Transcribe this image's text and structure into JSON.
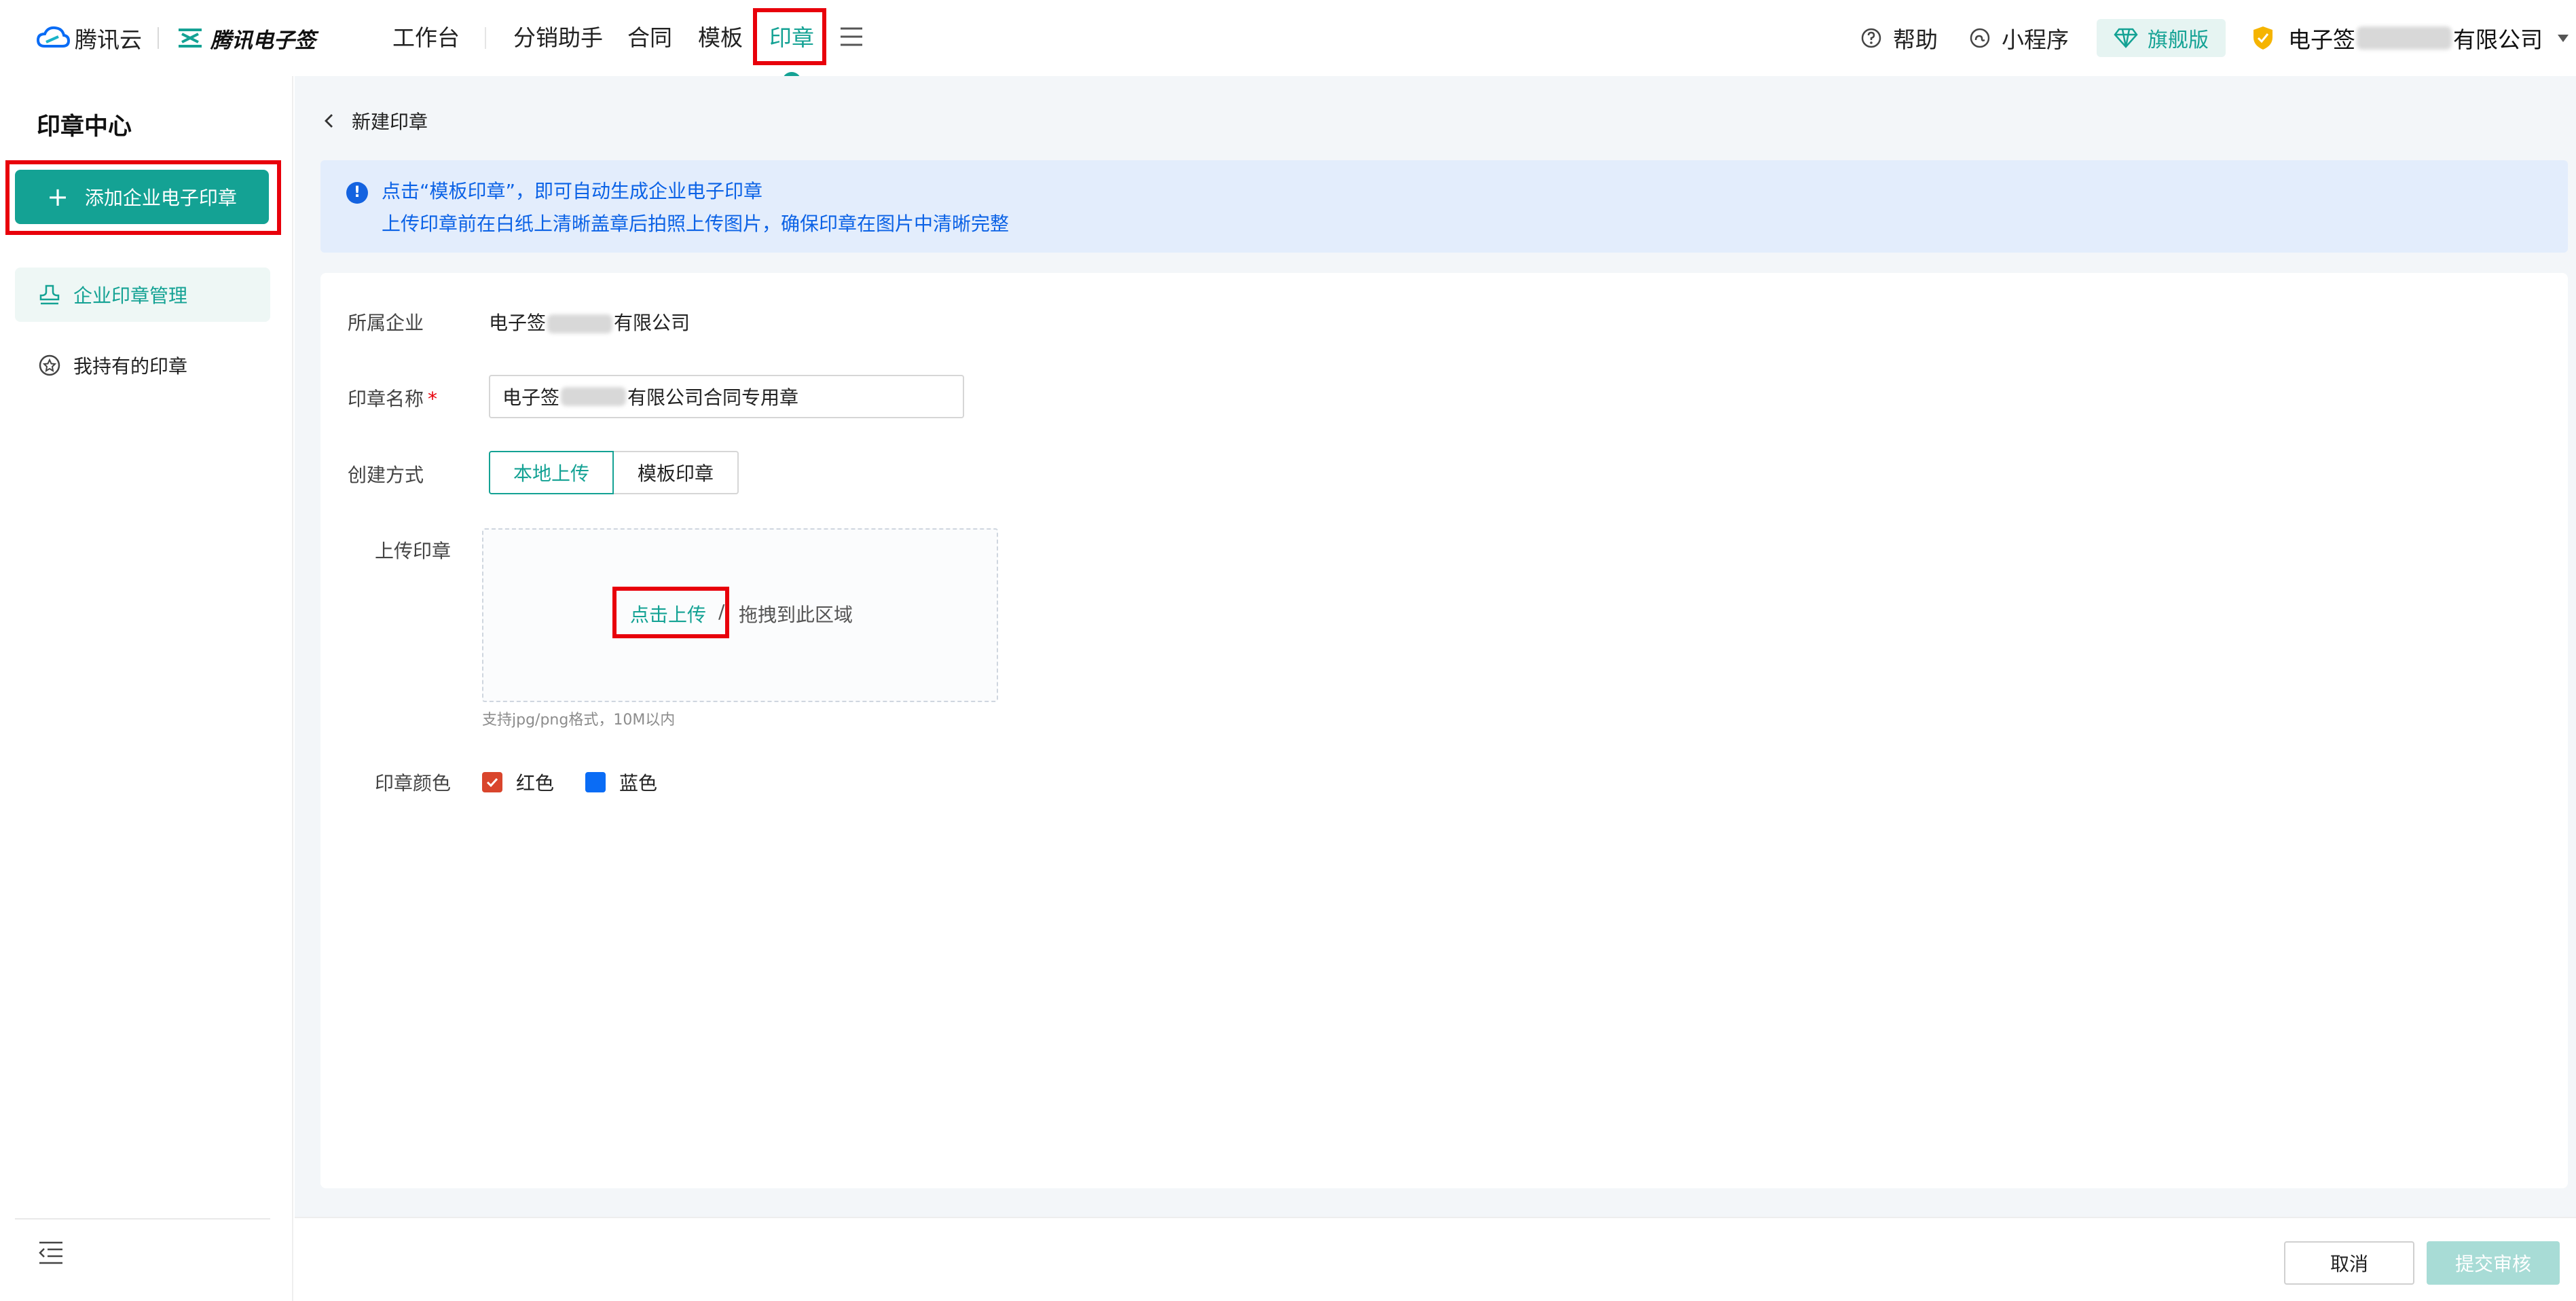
{
  "topbar": {
    "brand_tencent": "腾讯云",
    "brand_esign": "腾讯电子签",
    "nav": [
      {
        "label": "工作台"
      },
      {
        "label": "分销助手"
      },
      {
        "label": "合同"
      },
      {
        "label": "模板"
      },
      {
        "label": "印章",
        "active": true
      }
    ],
    "help_label": "帮助",
    "miniprogram_label": "小程序",
    "flagship_label": "旗舰版",
    "company_prefix": "电子签",
    "company_suffix": "有限公司"
  },
  "sidebar": {
    "title": "印章中心",
    "add_button": "添加企业电子印章",
    "items": [
      {
        "label": "企业印章管理",
        "active": true
      },
      {
        "label": "我持有的印章",
        "active": false
      }
    ]
  },
  "main": {
    "back_label": "新建印章",
    "notice_lines": [
      "点击“模板印章”，即可自动生成企业电子印章",
      "上传印章前在白纸上清晰盖章后拍照上传图片，确保印章在图片中清晰完整"
    ],
    "form": {
      "company_label": "所属企业",
      "company_prefix": "电子签",
      "company_suffix": "有限公司",
      "name_label": "印章名称",
      "name_required": "*",
      "name_prefix": "电子签",
      "name_suffix": "有限公司合同专用章",
      "method_label": "创建方式",
      "method_options": [
        "本地上传",
        "模板印章"
      ],
      "upload_label": "上传印章",
      "upload_link": "点击上传",
      "upload_slash": "/",
      "upload_drag": "拖拽到此区域",
      "upload_hint": "支持jpg/png格式，10M以内",
      "color_label": "印章颜色",
      "colors": [
        {
          "label": "红色",
          "hex": "#d9452c",
          "checked": true
        },
        {
          "label": "蓝色",
          "hex": "#0a6cf5",
          "checked": false
        }
      ]
    }
  },
  "footer": {
    "cancel_label": "取消",
    "submit_label": "提交审核"
  },
  "theme": {
    "accent": "#14a294",
    "highlight": "#e8000b",
    "notice_text": "#0b62e6"
  }
}
